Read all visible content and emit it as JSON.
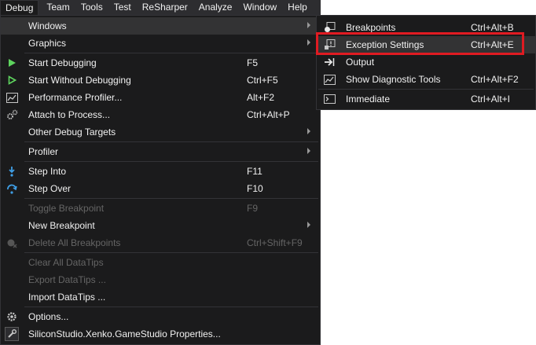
{
  "menubar": {
    "items": [
      "Debug",
      "Team",
      "Tools",
      "Test",
      "ReSharper",
      "Analyze",
      "Window",
      "Help"
    ]
  },
  "debug_menu": {
    "items": [
      {
        "label": "Windows",
        "shortcut": "",
        "submenu": true
      },
      {
        "label": "Graphics",
        "shortcut": "",
        "submenu": true
      },
      {
        "label": "Start Debugging",
        "shortcut": "F5"
      },
      {
        "label": "Start Without Debugging",
        "shortcut": "Ctrl+F5"
      },
      {
        "label": "Performance Profiler...",
        "shortcut": "Alt+F2"
      },
      {
        "label": "Attach to Process...",
        "shortcut": "Ctrl+Alt+P"
      },
      {
        "label": "Other Debug Targets",
        "shortcut": "",
        "submenu": true
      },
      {
        "label": "Profiler",
        "shortcut": "",
        "submenu": true
      },
      {
        "label": "Step Into",
        "shortcut": "F11"
      },
      {
        "label": "Step Over",
        "shortcut": "F10"
      },
      {
        "label": "Toggle Breakpoint",
        "shortcut": "F9",
        "disabled": true
      },
      {
        "label": "New Breakpoint",
        "shortcut": "",
        "submenu": true
      },
      {
        "label": "Delete All Breakpoints",
        "shortcut": "Ctrl+Shift+F9",
        "disabled": true
      },
      {
        "label": "Clear All DataTips",
        "shortcut": "",
        "disabled": true
      },
      {
        "label": "Export DataTips ...",
        "shortcut": "",
        "disabled": true
      },
      {
        "label": "Import DataTips ...",
        "shortcut": ""
      },
      {
        "label": "Options...",
        "shortcut": ""
      },
      {
        "label": "SiliconStudio.Xenko.GameStudio Properties...",
        "shortcut": ""
      }
    ]
  },
  "windows_submenu": {
    "items": [
      {
        "label": "Breakpoints",
        "shortcut": "Ctrl+Alt+B"
      },
      {
        "label": "Exception Settings",
        "shortcut": "Ctrl+Alt+E",
        "highlighted": true
      },
      {
        "label": "Output",
        "shortcut": ""
      },
      {
        "label": "Show Diagnostic Tools",
        "shortcut": "Ctrl+Alt+F2"
      },
      {
        "label": "Immediate",
        "shortcut": "Ctrl+Alt+I"
      }
    ]
  },
  "colors": {
    "menu_bg": "#1b1b1c",
    "menubar_bg": "#2d2d30",
    "hover_bg": "#333334",
    "disabled_text": "#656565",
    "highlight_border": "#e01b22"
  }
}
